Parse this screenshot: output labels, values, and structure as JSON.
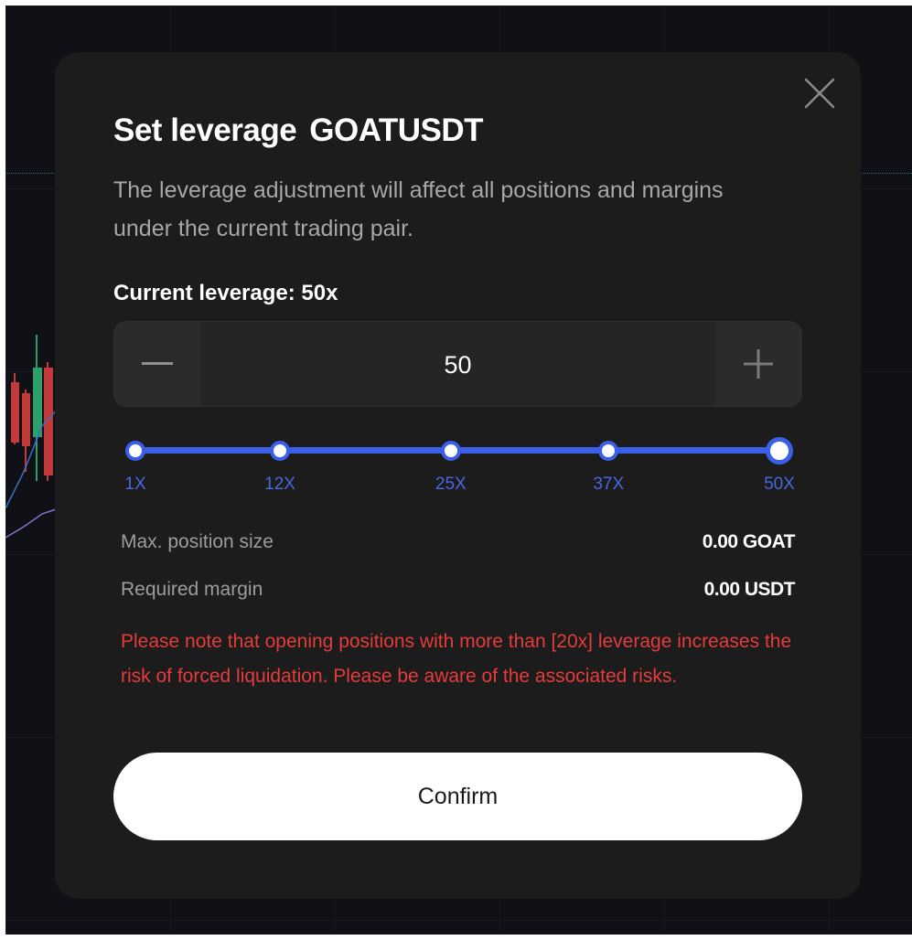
{
  "modal": {
    "title": "Set leverage",
    "pair": "GOATUSDT",
    "description": "The leverage adjustment will affect all positions and margins under the current trading pair.",
    "current_leverage_label": "Current leverage: 50x",
    "close_icon": "close-icon"
  },
  "stepper": {
    "value": "50",
    "minus_icon": "minus-icon",
    "plus_icon": "plus-icon"
  },
  "slider": {
    "min": 1,
    "max": 50,
    "value": 50,
    "accent_color": "#3b5fe6",
    "marks": [
      {
        "label": "1X",
        "value": 1
      },
      {
        "label": "12X",
        "value": 12
      },
      {
        "label": "25X",
        "value": 25
      },
      {
        "label": "37X",
        "value": 37
      },
      {
        "label": "50X",
        "value": 50
      }
    ]
  },
  "info": {
    "max_position_label": "Max. position size",
    "max_position_value": "0.00 GOAT",
    "required_margin_label": "Required margin",
    "required_margin_value": "0.00 USDT"
  },
  "warning": {
    "text": "Please note that opening positions with more than [20x] leverage increases the risk of forced liquidation. Please be aware of the associated risks.",
    "color": "#e53b3b"
  },
  "actions": {
    "confirm_label": "Confirm"
  }
}
